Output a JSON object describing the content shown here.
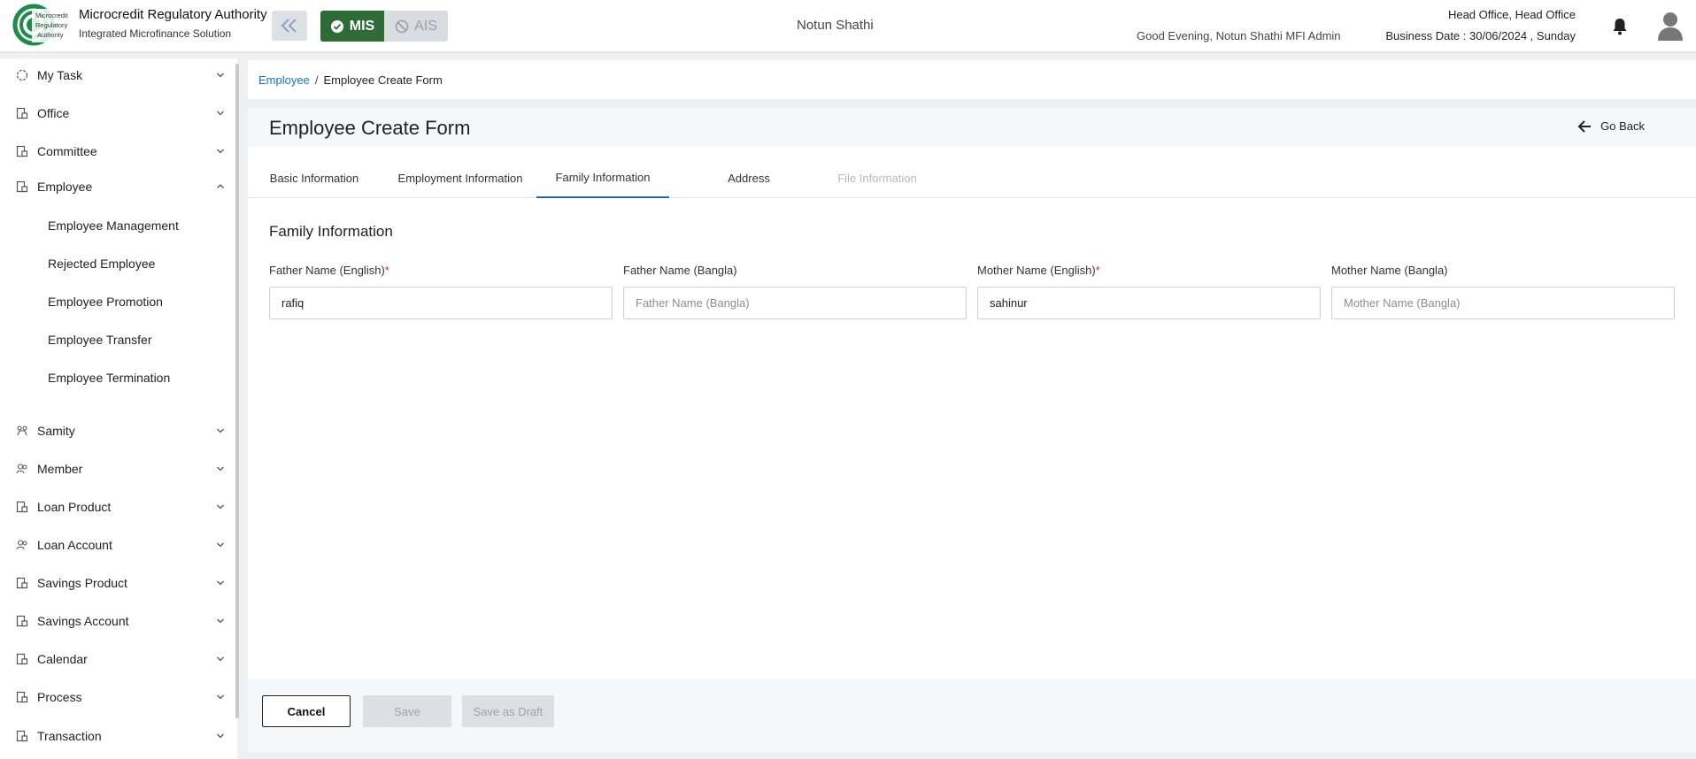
{
  "header": {
    "logo_lines": [
      "Microcredit",
      "Regulatory",
      "Authority"
    ],
    "app_title": "Microcredit Regulatory Authority",
    "app_subtitle": "Integrated Microfinance Solution",
    "mode_mis": "MIS",
    "mode_ais": "AIS",
    "org_name": "Notun Shathi",
    "greeting": "Good Evening, Notun Shathi MFI Admin",
    "office": "Head Office, Head Office",
    "business_date": "Business Date : 30/06/2024 , Sunday",
    "icons": [
      "double-chevron-left-icon",
      "check-circle-icon",
      "ban-icon",
      "bell-icon",
      "user-avatar-icon"
    ],
    "colors": {
      "mis_active": "#2e6b36",
      "ais_inactive": "#d8dbdf"
    }
  },
  "sidebar": {
    "items": [
      {
        "label": "My Task",
        "icon": "task-icon"
      },
      {
        "label": "Office",
        "icon": "office-icon"
      },
      {
        "label": "Committee",
        "icon": "committee-icon"
      },
      {
        "label": "Employee",
        "icon": "employee-icon",
        "expanded": true
      },
      {
        "label": "Samity",
        "icon": "samity-icon"
      },
      {
        "label": "Member",
        "icon": "member-icon"
      },
      {
        "label": "Loan Product",
        "icon": "loan-product-icon"
      },
      {
        "label": "Loan Account",
        "icon": "loan-account-icon"
      },
      {
        "label": "Savings Product",
        "icon": "savings-product-icon"
      },
      {
        "label": "Savings Account",
        "icon": "savings-account-icon"
      },
      {
        "label": "Calendar",
        "icon": "calendar-icon"
      },
      {
        "label": "Process",
        "icon": "process-icon"
      },
      {
        "label": "Transaction",
        "icon": "transaction-icon"
      }
    ],
    "employee_sub": [
      "Employee Management",
      "Rejected Employee",
      "Employee Promotion",
      "Employee Transfer",
      "Employee Termination"
    ]
  },
  "breadcrumb": {
    "parent": "Employee",
    "separator": "/",
    "current": "Employee Create Form"
  },
  "form": {
    "title": "Employee Create Form",
    "go_back": "Go Back",
    "tabs": [
      {
        "label": "Basic Information",
        "state": "normal"
      },
      {
        "label": "Employment Information",
        "state": "normal"
      },
      {
        "label": "Family Information",
        "state": "active"
      },
      {
        "label": "Address",
        "state": "normal"
      },
      {
        "label": "File Information",
        "state": "disabled"
      }
    ],
    "section_title": "Family Information",
    "required_mark": "*",
    "fields": [
      {
        "label": "Father Name (English)",
        "required": true,
        "value": "rafiq",
        "placeholder": "Father Name (English)"
      },
      {
        "label": "Father Name (Bangla)",
        "required": false,
        "value": "",
        "placeholder": "Father Name (Bangla)"
      },
      {
        "label": "Mother Name (English)",
        "required": true,
        "value": "sahinur",
        "placeholder": "Mother Name (English)"
      },
      {
        "label": "Mother Name (Bangla)",
        "required": false,
        "value": "",
        "placeholder": "Mother Name (Bangla)"
      }
    ],
    "buttons": {
      "cancel": "Cancel",
      "save": "Save",
      "save_draft": "Save as Draft"
    }
  }
}
